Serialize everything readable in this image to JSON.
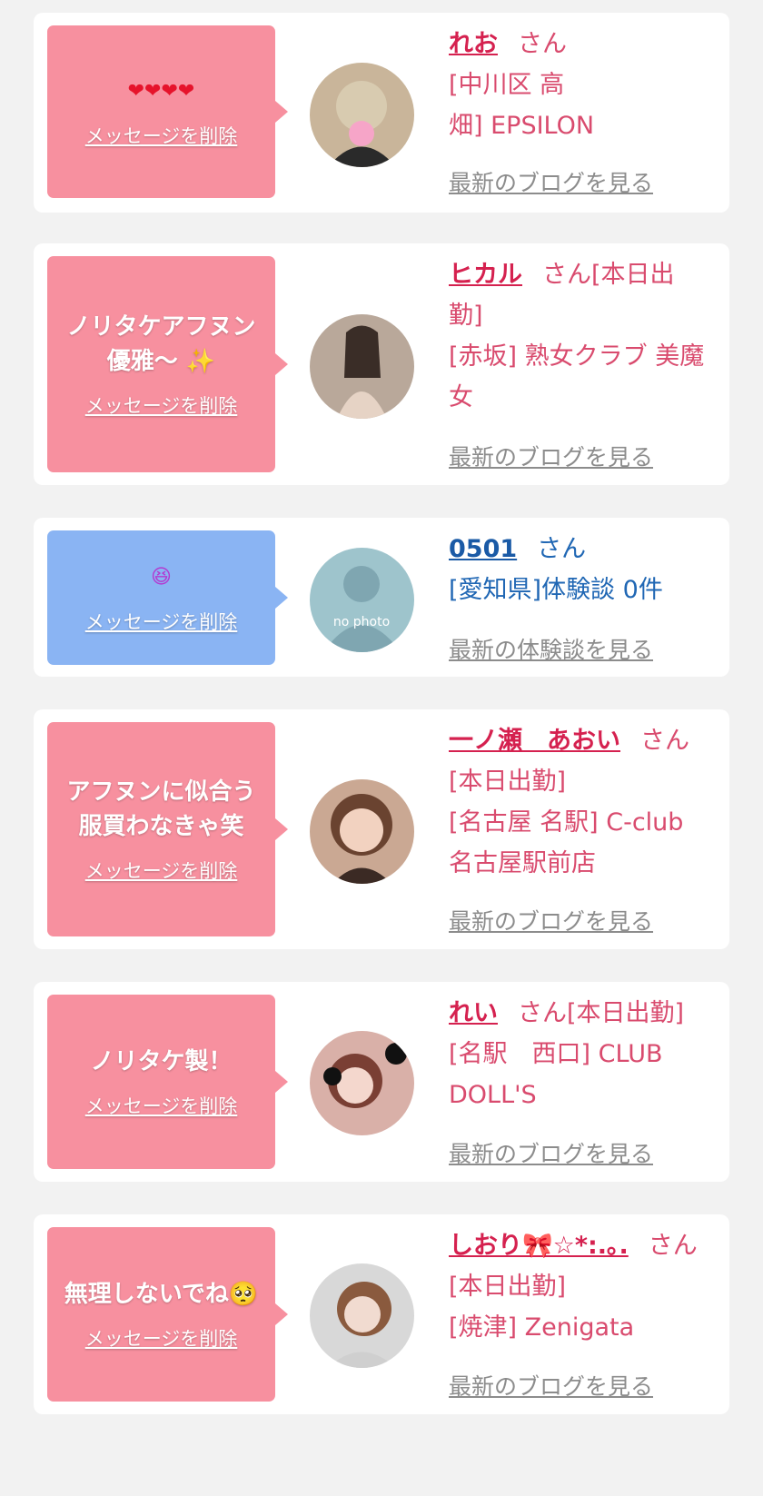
{
  "items": [
    {
      "message": "❤❤❤❤",
      "delete_label": "メッセージを削除",
      "name": "れお",
      "honorific": "さん",
      "detail_lines": [
        "[中川区 高",
        "畑] EPSILON"
      ],
      "link_label": "最新のブログを見る",
      "avatar": "girl-photo"
    },
    {
      "message": "ノリタケアフヌン\n優雅〜 ✨",
      "delete_label": "メッセージを削除",
      "name": "ヒカル",
      "honorific": "さん[本日出",
      "detail_lines": [
        "勤]",
        "[赤坂] 熟女クラブ 美魔",
        "女"
      ],
      "link_label": "最新のブログを見る",
      "avatar": "girl-photo"
    },
    {
      "message": "😆",
      "delete_label": "メッセージを削除",
      "name": "0501",
      "honorific": "さん",
      "detail_lines": [
        "[愛知県]体験談 0件"
      ],
      "link_label": "最新の体験談を見る",
      "avatar": "no photo"
    },
    {
      "message": "アフヌンに似合う\n服買わなきゃ笑",
      "delete_label": "メッセージを削除",
      "name": "一ノ瀬　あおい",
      "honorific": "さん",
      "detail_lines": [
        "[本日出勤]",
        "[名古屋 名駅] C-club",
        "名古屋駅前店"
      ],
      "link_label": "最新のブログを見る",
      "avatar": "girl-photo"
    },
    {
      "message": "ノリタケ製！",
      "delete_label": "メッセージを削除",
      "name": "れい",
      "honorific": "さん[本日出勤]",
      "detail_lines": [
        "[名駅　西口] CLUB",
        "DOLL'S"
      ],
      "link_label": "最新のブログを見る",
      "avatar": "girl-photo"
    },
    {
      "message": "無理しないでね🥺",
      "delete_label": "メッセージを削除",
      "name": "しおり🎀☆*:.｡.",
      "honorific": "さん",
      "detail_lines": [
        "[本日出勤]",
        "[焼津] Zenigata"
      ],
      "link_label": "最新のブログを見る",
      "avatar": "girl-photo"
    }
  ],
  "colors": {
    "bubble_pink": "#f7909f",
    "bubble_blue": "#8ab4f3",
    "name_pink": "#d5214f",
    "name_blue": "#1a5aa6"
  }
}
